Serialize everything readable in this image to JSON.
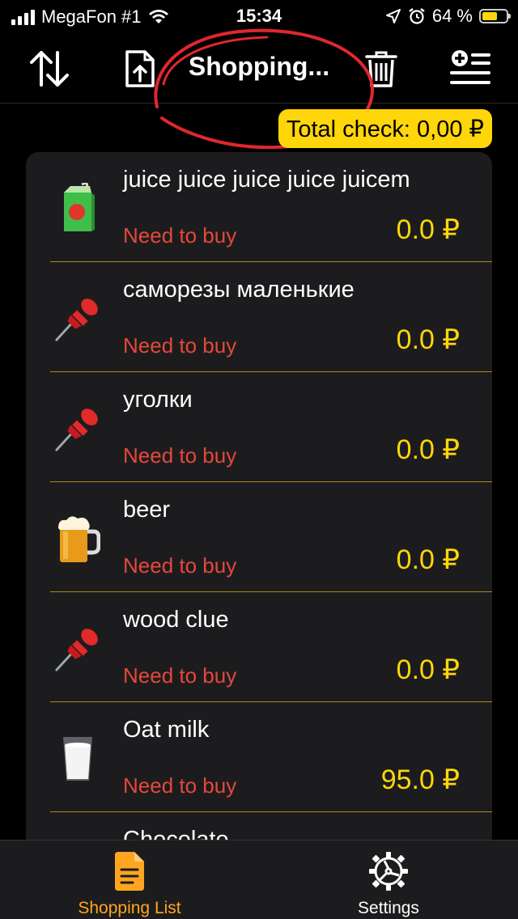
{
  "status_bar": {
    "carrier": "MegaFon #1",
    "time": "15:34",
    "battery_percent": "64 %",
    "battery_level": 0.64
  },
  "nav": {
    "title": "Shopping...",
    "icons": [
      "sort-icon",
      "export-icon",
      "trash-icon",
      "add-list-icon"
    ]
  },
  "total": {
    "label": "Total check: 0,00 ₽"
  },
  "items": [
    {
      "name": "juice juice juice juice juicem",
      "status": "Need to buy",
      "price": "0.0 ₽",
      "icon": "juice-box-icon"
    },
    {
      "name": "саморезы маленькие",
      "status": "Need to buy",
      "price": "0.0 ₽",
      "icon": "pushpin-icon"
    },
    {
      "name": "уголки",
      "status": "Need to buy",
      "price": "0.0 ₽",
      "icon": "pushpin-icon"
    },
    {
      "name": "beer",
      "status": "Need to buy",
      "price": "0.0 ₽",
      "icon": "beer-mug-icon"
    },
    {
      "name": "wood clue",
      "status": "Need to buy",
      "price": "0.0 ₽",
      "icon": "pushpin-icon"
    },
    {
      "name": "Oat milk",
      "status": "Need to buy",
      "price": "95.0 ₽",
      "icon": "milk-glass-icon"
    },
    {
      "name": "Chocolate",
      "status": "",
      "price": "",
      "icon": ""
    }
  ],
  "tabs": [
    {
      "label": "Shopping List",
      "icon": "document-icon",
      "active": true
    },
    {
      "label": "Settings",
      "icon": "gear-icon",
      "active": false
    }
  ],
  "colors": {
    "accent": "#ffd60a",
    "status_red": "#e5483b",
    "tab_active": "#ffa51f",
    "card_bg": "#1c1c1e"
  }
}
